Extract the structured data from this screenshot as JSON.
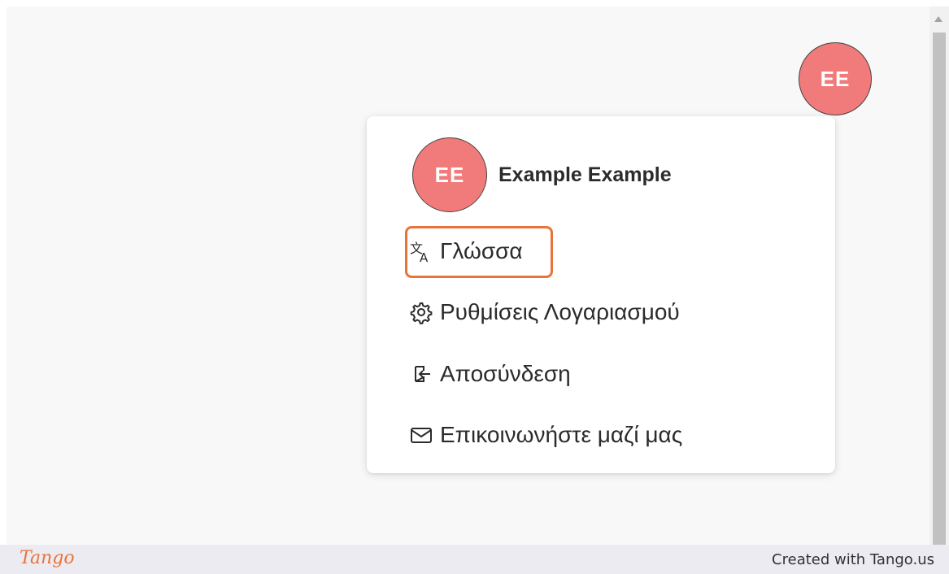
{
  "header": {
    "avatar_initials": "EE"
  },
  "menu": {
    "user_initials": "EE",
    "user_name": "Example Example",
    "items": [
      {
        "label": "Γλώσσα",
        "icon": "translate-icon"
      },
      {
        "label": "Ρυθμίσεις Λογαριασμού",
        "icon": "gear-icon"
      },
      {
        "label": "Αποσύνδεση",
        "icon": "logout-icon"
      },
      {
        "label": "Επικοινωνήστε μαζί μας",
        "icon": "mail-icon"
      }
    ],
    "highlighted_item": "Γλώσσα"
  },
  "footer": {
    "logo_text": "Tango",
    "credit": "Created with Tango.us"
  },
  "colors": {
    "avatar": "#f07b7a",
    "highlight": "#e8743a",
    "footer_bg": "#edebf2"
  }
}
